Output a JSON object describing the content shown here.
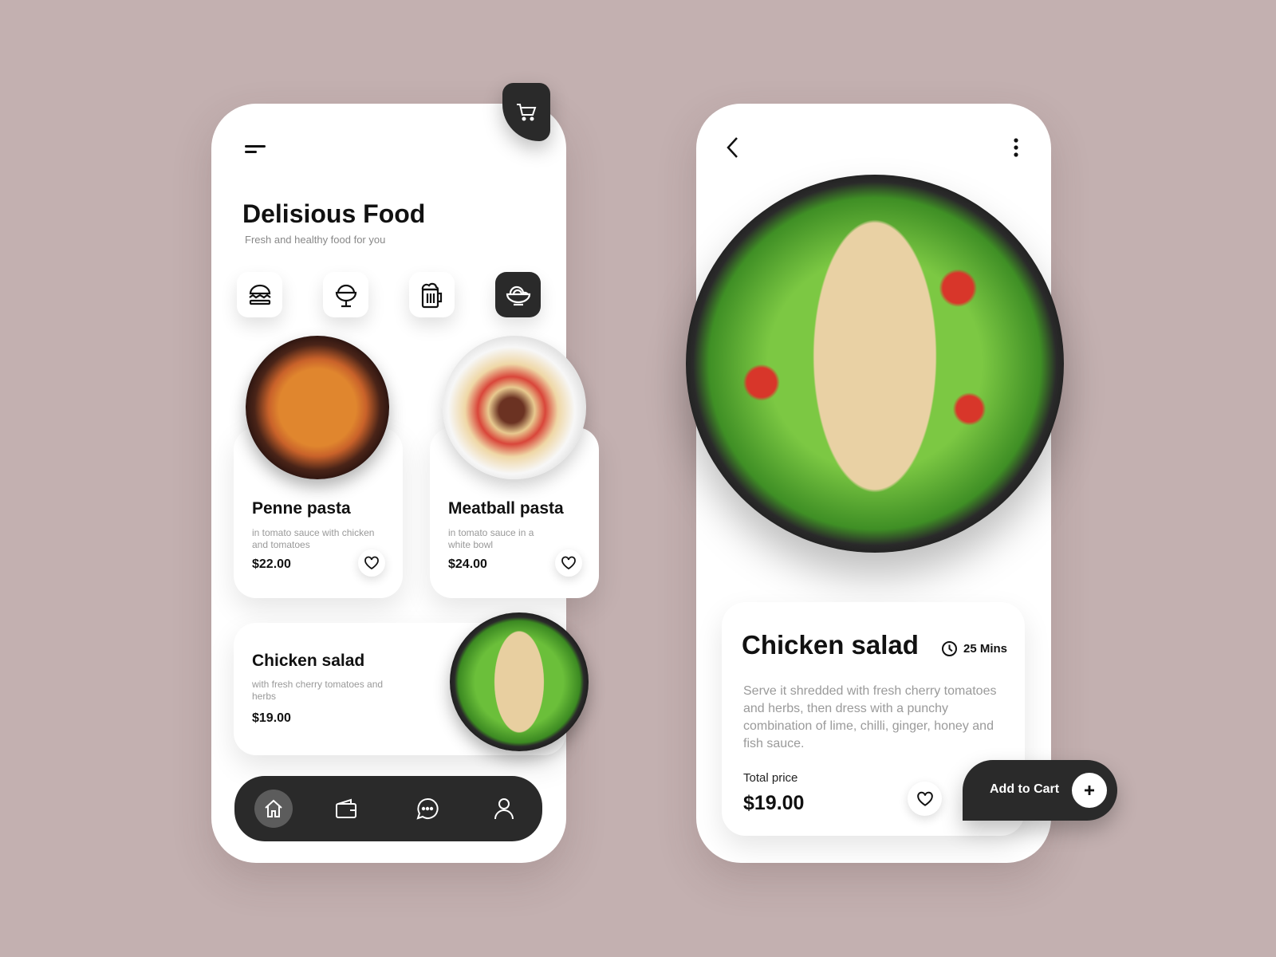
{
  "colors": {
    "background": "#c3b0b0",
    "dark": "#2a2a2a",
    "card": "#ffffff",
    "muted_text": "#999999"
  },
  "home": {
    "title": "Delisious Food",
    "subtitle": "Fresh and healthy food for you",
    "menu_icon": "menu-icon",
    "cart_icon": "cart-icon",
    "categories": [
      {
        "icon": "burger-icon",
        "active": false
      },
      {
        "icon": "ice-cream-icon",
        "active": false
      },
      {
        "icon": "beer-mug-icon",
        "active": false
      },
      {
        "icon": "noodle-bowl-icon",
        "active": true
      }
    ],
    "items": [
      {
        "name": "Penne pasta",
        "desc": "in tomato sauce with chicken and tomatoes",
        "price": "$22.00"
      },
      {
        "name": "Meatball pasta",
        "desc": "in tomato sauce in a white bowl",
        "price": "$24.00"
      },
      {
        "name": "Chicken salad",
        "desc": "with fresh cherry tomatoes and herbs",
        "price": "$19.00"
      }
    ],
    "nav": [
      {
        "icon": "home-icon",
        "active": true
      },
      {
        "icon": "wallet-icon"
      },
      {
        "icon": "chat-icon"
      },
      {
        "icon": "profile-icon"
      }
    ]
  },
  "detail": {
    "title": "Chicken salad",
    "time": "25 Mins",
    "description": "Serve it shredded with fresh cherry tomatoes and herbs, then dress with a punchy combination of lime, chilli, ginger, honey and fish sauce.",
    "total_label": "Total price",
    "total": "$19.00",
    "add_to_cart": "Add to Cart"
  }
}
